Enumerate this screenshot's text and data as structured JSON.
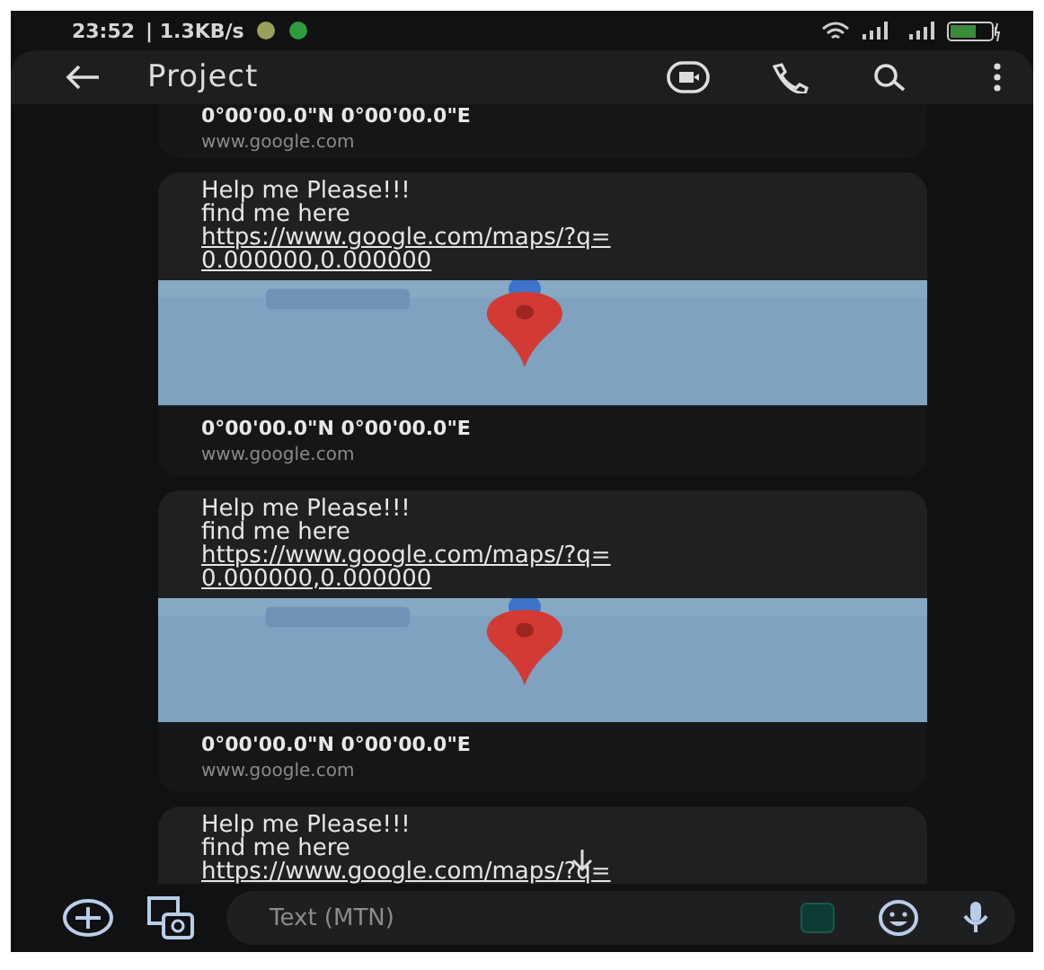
{
  "status_bar": {
    "time": "23:52",
    "speed": "| 1.3KB/s"
  },
  "header": {
    "title": "Project"
  },
  "messages": [
    {
      "kind": "footer",
      "coords": "0°00'00.0\"N 0°00'00.0\"E",
      "site": "www.google.com"
    },
    {
      "kind": "location",
      "lines": [
        "Help me Please!!!",
        "find me here"
      ],
      "link_lines": [
        "https://www.google.com/maps/?q=",
        "0.000000,0.000000"
      ],
      "coords": "0°00'00.0\"N 0°00'00.0\"E",
      "site": "www.google.com"
    },
    {
      "kind": "location",
      "lines": [
        "Help me Please!!!",
        "find me here"
      ],
      "link_lines": [
        "https://www.google.com/maps/?q=",
        "0.000000,0.000000"
      ],
      "coords": "0°00'00.0\"N 0°00'00.0\"E",
      "site": "www.google.com"
    },
    {
      "kind": "text",
      "lines": [
        "Help me Please!!!",
        "find me here"
      ],
      "link_lines": [
        "https://www.google.com/maps/?q="
      ]
    }
  ],
  "composer": {
    "placeholder": "Text (MTN)"
  }
}
